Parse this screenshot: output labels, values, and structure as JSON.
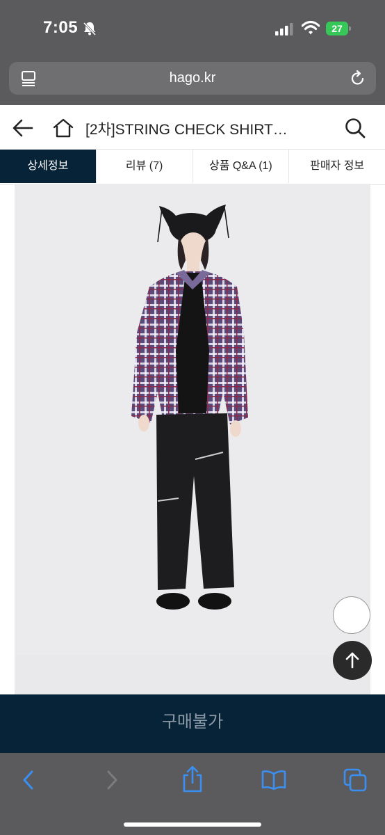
{
  "status_bar": {
    "time": "7:05",
    "battery": "27"
  },
  "browser": {
    "url": "hago.kr"
  },
  "header": {
    "title": "[2차]STRING CHECK SHIRT…"
  },
  "tabs": [
    {
      "label": "상세정보",
      "active": true
    },
    {
      "label": "리뷰 (7)",
      "active": false
    },
    {
      "label": "상품 Q&A (1)",
      "active": false
    },
    {
      "label": "판매자 정보",
      "active": false
    }
  ],
  "purchase": {
    "label": "구매불가"
  },
  "colors": {
    "navy": "#072338",
    "chrome": "#5b5b5d",
    "accent_blue": "#3b8ff0",
    "battery_green": "#37c759"
  },
  "icons": [
    "bell-off-icon",
    "signal-icon",
    "wifi-icon",
    "tabs-page-icon",
    "reload-icon",
    "back-arrow-icon",
    "home-icon",
    "search-icon",
    "arrow-up-icon",
    "chevron-left-icon",
    "chevron-right-icon",
    "share-icon",
    "bookmarks-icon",
    "tabs-icon"
  ]
}
